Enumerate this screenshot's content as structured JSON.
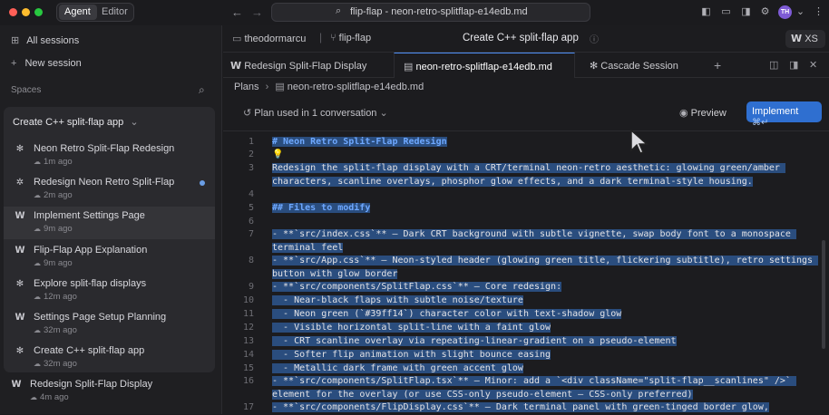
{
  "topbar": {
    "mode_agent": "Agent",
    "mode_editor": "Editor",
    "search_text": "flip-flap - neon-retro-splitflap-e14edb.md",
    "avatar": "TH"
  },
  "sidebar": {
    "all_sessions": "All sessions",
    "new_session": "New session",
    "spaces": "Spaces",
    "space_title": "Create C++ split-flap app",
    "sessions": [
      {
        "name": "Neon Retro Split-Flap Redesign",
        "time": "1m ago",
        "icon": "flower-icon"
      },
      {
        "name": "Redesign Neon Retro Split-Flap",
        "time": "2m ago",
        "icon": "spinner-icon",
        "dot": true
      },
      {
        "name": "Implement Settings Page",
        "time": "9m ago",
        "icon": "windsurf-icon",
        "active": true
      },
      {
        "name": "Flip-Flap App Explanation",
        "time": "9m ago",
        "icon": "windsurf-icon"
      },
      {
        "name": "Explore split-flap displays",
        "time": "12m ago",
        "icon": "flower-icon"
      },
      {
        "name": "Settings Page Setup Planning",
        "time": "32m ago",
        "icon": "windsurf-icon"
      },
      {
        "name": "Create C++ split-flap app",
        "time": "32m ago",
        "icon": "flower-icon"
      }
    ],
    "extra_session": {
      "name": "Redesign Split-Flap Display",
      "time": "4m ago"
    }
  },
  "crumbbar": {
    "user": "theodormarcu",
    "repo": "flip-flap",
    "title": "Create C++ split-flap app",
    "size": "XS"
  },
  "tabs": [
    {
      "label": "Redesign Split-Flap Display"
    },
    {
      "label": "neon-retro-splitflap-e14edb.md"
    },
    {
      "label": "Cascade Session"
    }
  ],
  "plans": {
    "root": "Plans",
    "file": "neon-retro-splitflap-e14edb.md"
  },
  "toolbar": {
    "plan_used": "Plan used in 1 conversation",
    "preview": "Preview",
    "implement": "Implement",
    "shortcut": "⌘↵"
  },
  "editor": {
    "lines": [
      {
        "n": "1",
        "text": "# Neon Retro Split-Flap Redesign"
      },
      {
        "n": "2",
        "text": "💡"
      },
      {
        "n": "3",
        "text": "Redesign the split-flap display with a CRT/terminal neon-retro aesthetic: glowing green/amber characters, scanline overlays, phosphor glow effects, and a dark terminal-style housing."
      },
      {
        "n": "4",
        "text": ""
      },
      {
        "n": "5",
        "text": "## Files to modify"
      },
      {
        "n": "6",
        "text": ""
      },
      {
        "n": "7",
        "text": "- **`src/index.css`** — Dark CRT background with subtle vignette, swap body font to a monospace terminal feel"
      },
      {
        "n": "8",
        "text": "- **`src/App.css`** — Neon-styled header (glowing green title, flickering subtitle), retro settings button with glow border"
      },
      {
        "n": "9",
        "text": "- **`src/components/SplitFlap.css`** — Core redesign:"
      },
      {
        "n": "10",
        "text": "  - Near-black flaps with subtle noise/texture"
      },
      {
        "n": "11",
        "text": "  - Neon green (`#39ff14`) character color with text-shadow glow"
      },
      {
        "n": "12",
        "text": "  - Visible horizontal split-line with a faint glow"
      },
      {
        "n": "13",
        "text": "  - CRT scanline overlay via repeating-linear-gradient on a pseudo-element"
      },
      {
        "n": "14",
        "text": "  - Softer flip animation with slight bounce easing"
      },
      {
        "n": "15",
        "text": "  - Metallic dark frame with green accent glow"
      },
      {
        "n": "16",
        "text": "- **`src/components/SplitFlap.tsx`** — Minor: add a `<div className=\"split-flap__scanlines\" />` element for the overlay (or use CSS-only pseudo-element — CSS-only preferred)"
      },
      {
        "n": "17",
        "text": "- **`src/components/FlipDisplay.css`** — Dark terminal panel with green-tinged border glow,"
      }
    ]
  }
}
